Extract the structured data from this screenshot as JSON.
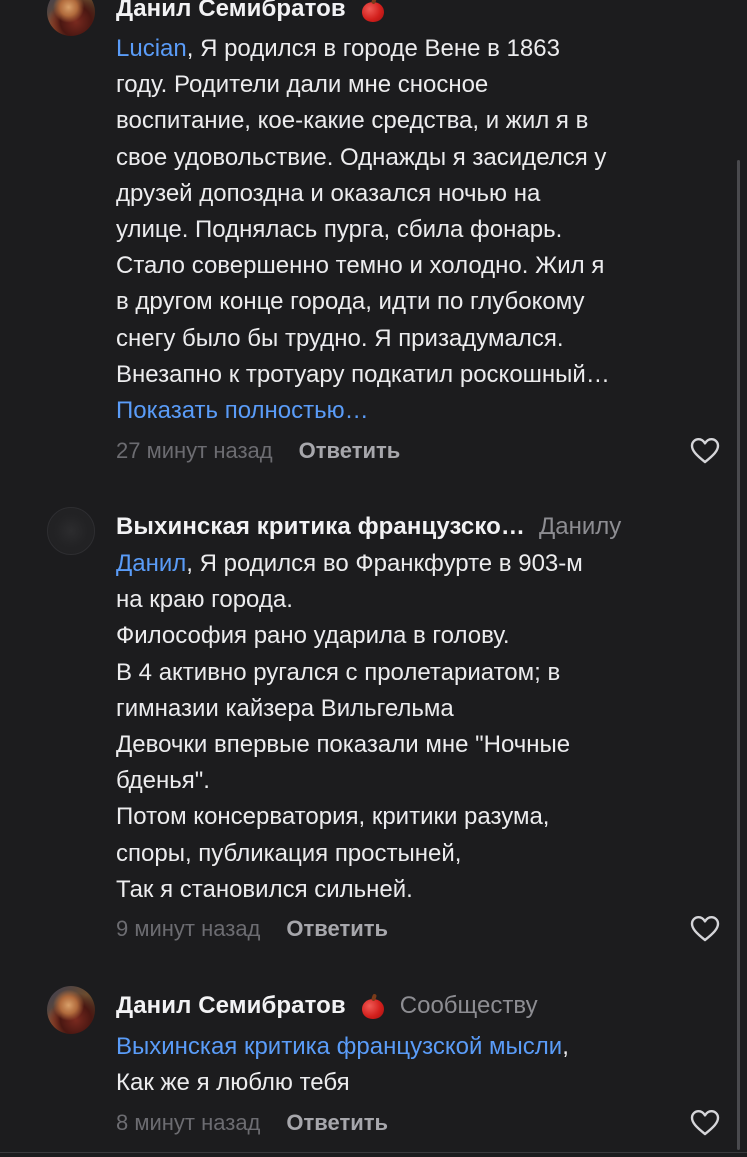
{
  "comments": [
    {
      "author": "Данил Семибратов",
      "has_apple_badge": true,
      "mention": "Lucian",
      "lines": [
        ", Я родился в городе Вене в 1863",
        "году. Родители дали мне сносное",
        "воспитание, кое-какие средства, и жил я в",
        "свое удовольствие. Однажды я засиделся у",
        "друзей допоздна и оказался ночью на",
        "улице. Поднялась пурга, сбила фонарь.",
        "Стало совершенно темно и холодно. Жил я",
        "в другом конце города, идти по глубокому",
        "снегу было бы трудно. Я призадумался.",
        "Внезапно к тротуару подкатил роскошный…"
      ],
      "show_more": "Показать полностью…",
      "time": "27 минут назад",
      "reply": "Ответить"
    },
    {
      "author": "Выхинская критика французско…",
      "reply_to": "Данилу",
      "mention": "Данил",
      "lines": [
        ", Я родился во Франкфурте в 903-м",
        "на краю города.",
        "Философия рано ударила в голову.",
        "В 4 активно ругался с пролетариатом; в",
        "гимназии кайзера Вильгельма",
        "Девочки впервые показали мне \"Ночные",
        "бденья\".",
        "Потом консерватория, критики разума,",
        "споры, публикация простыней,",
        "Так я становился сильней."
      ],
      "time": "9 минут назад",
      "reply": "Ответить"
    },
    {
      "author": "Данил Семибратов",
      "has_apple_badge": true,
      "reply_to": "Сообществу",
      "mention": "Выхинская критика французской мысли",
      "lines": [
        ",",
        "Как же я люблю тебя"
      ],
      "time": "8 минут назад",
      "reply": "Ответить"
    }
  ],
  "colors": {
    "background": "#1c1c1e",
    "mention": "#5a9cf8",
    "text": "#ececee",
    "muted": "#6c6c71"
  },
  "icons": {
    "like": "heart-outline-icon",
    "badge": "apple-icon"
  }
}
